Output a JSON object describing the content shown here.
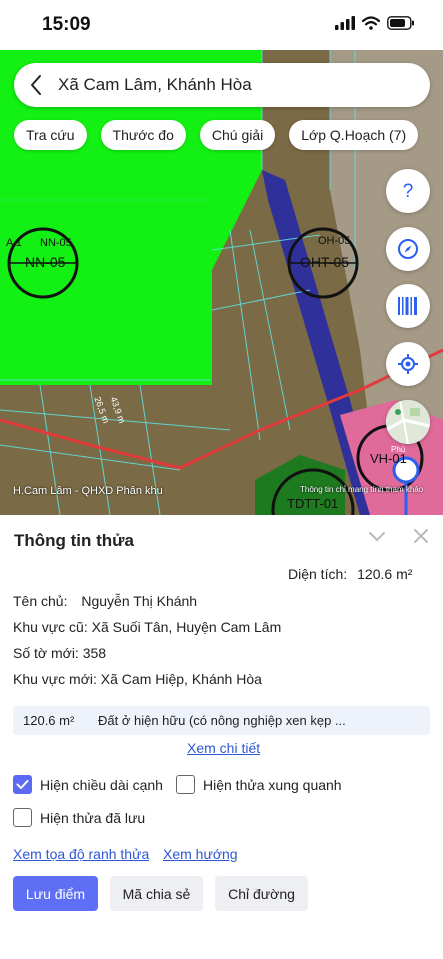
{
  "status": {
    "time": "15:09"
  },
  "search": {
    "title": "Xã Cam Lâm, Khánh Hòa"
  },
  "chips": [
    "Tra cứu",
    "Thước đo",
    "Chú giải",
    "Lớp Q.Hoạch (7)"
  ],
  "map": {
    "source": "H.Cam Lâm - QHXD Phân khu",
    "note": "Thông tin chỉ mang tính tham khảo",
    "labels": {
      "nn05_top": "NN-05",
      "nn05_main": "NN-05",
      "a1": "A 1",
      "oht_top": "OH-05",
      "oht_main": "OHT-05",
      "vh": "VH-01",
      "tdtt": "TDTT-01",
      "phu": "Phú",
      "dim": "26,5 m",
      "dim2": "43,9 m"
    }
  },
  "panel": {
    "title": "Thông tin thửa",
    "area_label": "Diện tích:",
    "area_value": "120.6 m²",
    "owner_label": "Tên chủ:",
    "owner_value": "Nguyễn Thị Khánh",
    "old_area_label": "Khu vực cũ:",
    "old_area_value": "Xã Suối Tân, Huyện Cam Lâm",
    "new_sheet_label": "Số tờ mới:",
    "new_sheet_value": "358",
    "new_area_label": "Khu vực mới:",
    "new_area_value": "Xã Cam Hiệp, Khánh Hòa",
    "land_area": "120.6 m²",
    "land_desc": "Đất ở hiện hữu (có nông nghiệp xen kẹp ...",
    "detail_link": "Xem chi tiết",
    "opt_edge": "Hiện chiều dài cạnh",
    "opt_neighbors": "Hiện thửa xung quanh",
    "opt_saved": "Hiện thửa đã lưu",
    "coords_link": "Xem tọa độ ranh thửa",
    "direction_link": "Xem hướng",
    "save_btn": "Lưu điểm",
    "share_btn": "Mã chia sẻ",
    "route_btn": "Chỉ đường"
  },
  "options": {
    "edge_checked": true,
    "neighbors_checked": false,
    "saved_checked": false
  },
  "colors": {
    "accent": "#5e6ef5",
    "link": "#2f57d6",
    "green_zone": "#13f013",
    "brown_zone": "#7a6a45",
    "pink_zone": "#e06a9a"
  }
}
